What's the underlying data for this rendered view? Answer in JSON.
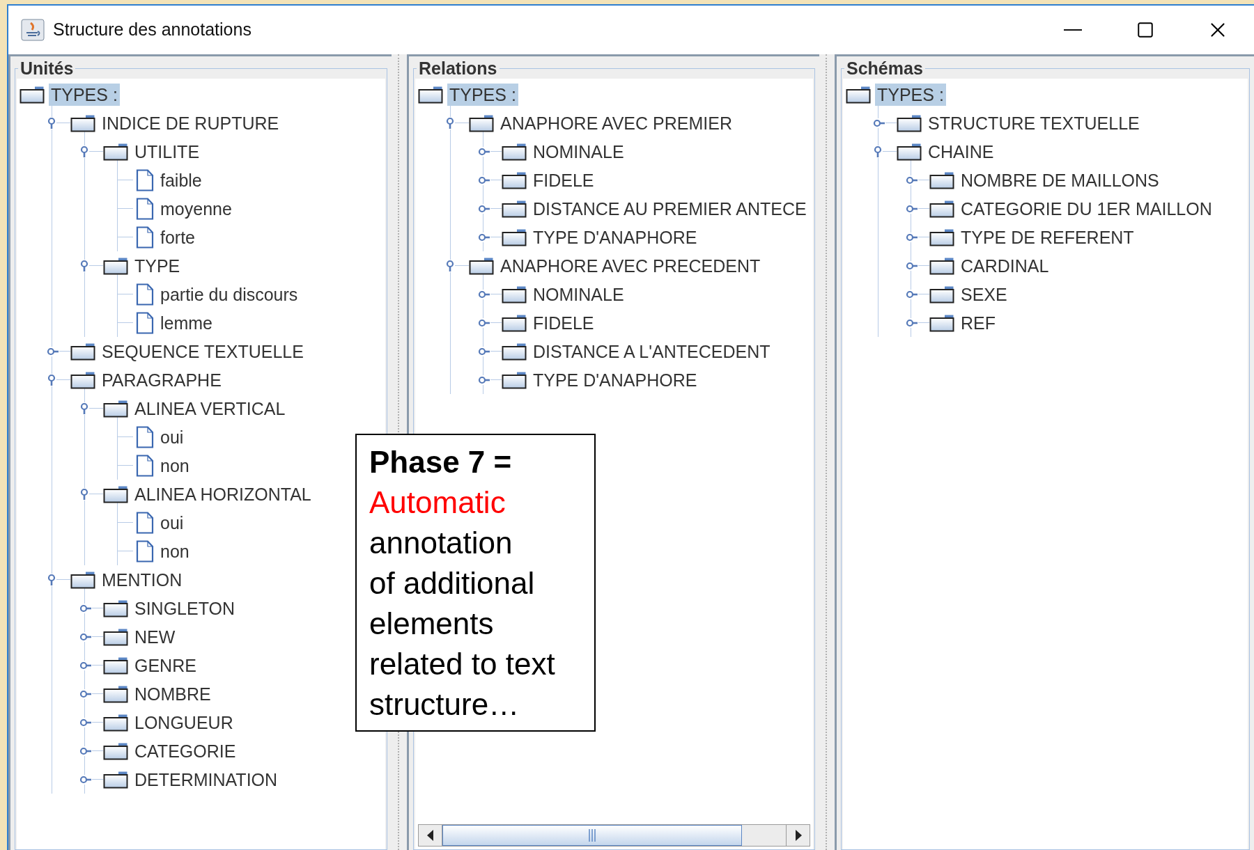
{
  "window": {
    "title": "Structure des annotations"
  },
  "panels": [
    {
      "title": "Unités",
      "tree": {
        "label": "TYPES :",
        "selected": true,
        "children": [
          {
            "label": "INDICE DE RUPTURE",
            "kind": "folder",
            "selected": false,
            "expanded": true,
            "children": [
              {
                "label": "UTILITE",
                "kind": "folder",
                "selected": false,
                "expanded": true,
                "children": [
                  {
                    "label": "faible",
                    "kind": "leaf",
                    "selected": false
                  },
                  {
                    "label": "moyenne",
                    "kind": "leaf",
                    "selected": false
                  },
                  {
                    "label": "forte",
                    "kind": "leaf",
                    "selected": false
                  }
                ]
              },
              {
                "label": "TYPE",
                "kind": "folder",
                "selected": false,
                "expanded": true,
                "children": [
                  {
                    "label": "partie du discours",
                    "kind": "leaf",
                    "selected": false
                  },
                  {
                    "label": "lemme",
                    "kind": "leaf",
                    "selected": false
                  }
                ]
              }
            ]
          },
          {
            "label": "SEQUENCE TEXTUELLE",
            "kind": "folder",
            "selected": false,
            "expanded": false
          },
          {
            "label": "PARAGRAPHE",
            "kind": "folder",
            "selected": false,
            "expanded": true,
            "children": [
              {
                "label": "ALINEA VERTICAL",
                "kind": "folder",
                "selected": false,
                "expanded": true,
                "children": [
                  {
                    "label": "oui",
                    "kind": "leaf",
                    "selected": false
                  },
                  {
                    "label": "non",
                    "kind": "leaf",
                    "selected": false
                  }
                ]
              },
              {
                "label": "ALINEA HORIZONTAL",
                "kind": "folder",
                "selected": false,
                "expanded": true,
                "children": [
                  {
                    "label": "oui",
                    "kind": "leaf",
                    "selected": false
                  },
                  {
                    "label": "non",
                    "kind": "leaf",
                    "selected": false
                  }
                ]
              }
            ]
          },
          {
            "label": "MENTION",
            "kind": "folder",
            "selected": false,
            "expanded": true,
            "children": [
              {
                "label": "SINGLETON",
                "kind": "folder",
                "selected": false,
                "expanded": false
              },
              {
                "label": "NEW",
                "kind": "folder",
                "selected": false,
                "expanded": false
              },
              {
                "label": "GENRE",
                "kind": "folder",
                "selected": false,
                "expanded": false
              },
              {
                "label": "NOMBRE",
                "kind": "folder",
                "selected": false,
                "expanded": false
              },
              {
                "label": "LONGUEUR",
                "kind": "folder",
                "selected": false,
                "expanded": false
              },
              {
                "label": "CATEGORIE",
                "kind": "folder",
                "selected": false,
                "expanded": false
              },
              {
                "label": "DETERMINATION",
                "kind": "folder",
                "selected": false,
                "expanded": false
              }
            ]
          }
        ]
      }
    },
    {
      "title": "Relations",
      "horizontal_scrollbar": true,
      "tree": {
        "label": "TYPES :",
        "selected": true,
        "children": [
          {
            "label": "ANAPHORE AVEC PREMIER",
            "kind": "folder",
            "selected": false,
            "expanded": true,
            "children": [
              {
                "label": "NOMINALE",
                "kind": "folder",
                "selected": false,
                "expanded": false
              },
              {
                "label": "FIDELE",
                "kind": "folder",
                "selected": false,
                "expanded": false
              },
              {
                "label": "DISTANCE AU PREMIER ANTECE",
                "kind": "folder",
                "selected": false,
                "expanded": false
              },
              {
                "label": "TYPE D'ANAPHORE",
                "kind": "folder",
                "selected": false,
                "expanded": false
              }
            ]
          },
          {
            "label": "ANAPHORE AVEC PRECEDENT",
            "kind": "folder",
            "selected": false,
            "expanded": true,
            "children": [
              {
                "label": "NOMINALE",
                "kind": "folder",
                "selected": false,
                "expanded": false
              },
              {
                "label": "FIDELE",
                "kind": "folder",
                "selected": false,
                "expanded": false
              },
              {
                "label": "DISTANCE A L'ANTECEDENT",
                "kind": "folder",
                "selected": false,
                "expanded": false
              },
              {
                "label": "TYPE D'ANAPHORE",
                "kind": "folder",
                "selected": false,
                "expanded": false
              }
            ]
          }
        ]
      }
    },
    {
      "title": "Schémas",
      "tree": {
        "label": "TYPES :",
        "selected": true,
        "children": [
          {
            "label": "STRUCTURE TEXTUELLE",
            "kind": "folder",
            "selected": false,
            "expanded": false
          },
          {
            "label": "CHAINE",
            "kind": "folder",
            "selected": false,
            "expanded": true,
            "children": [
              {
                "label": "NOMBRE DE MAILLONS",
                "kind": "folder",
                "selected": false,
                "expanded": false
              },
              {
                "label": "CATEGORIE DU 1ER MAILLON",
                "kind": "folder",
                "selected": false,
                "expanded": false
              },
              {
                "label": "TYPE DE REFERENT",
                "kind": "folder",
                "selected": false,
                "expanded": false
              },
              {
                "label": "CARDINAL",
                "kind": "folder",
                "selected": false,
                "expanded": false
              },
              {
                "label": "SEXE",
                "kind": "folder",
                "selected": false,
                "expanded": false
              },
              {
                "label": "REF",
                "kind": "folder",
                "selected": false,
                "expanded": false
              }
            ]
          }
        ]
      }
    }
  ],
  "callout": {
    "heading": "Phase 7 =",
    "highlight": "Automatic",
    "lines": [
      "annotation",
      "of additional",
      "elements",
      "related to text",
      "structure…"
    ]
  }
}
